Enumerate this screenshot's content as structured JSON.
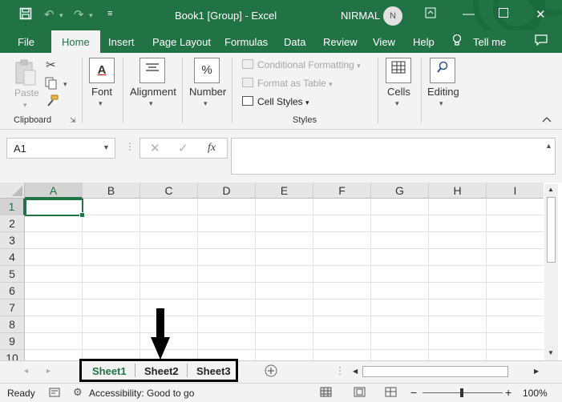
{
  "titlebar": {
    "title": "Book1  [Group]  -  Excel",
    "user": "NIRMAL",
    "avatar_initial": "N",
    "save_icon": "save-icon",
    "undo_icon": "undo-icon",
    "redo_icon": "redo-icon"
  },
  "tabs": [
    "File",
    "Home",
    "Insert",
    "Page Layout",
    "Formulas",
    "Data",
    "Review",
    "View",
    "Help",
    "Tell me"
  ],
  "ribbon": {
    "paste": "Paste",
    "clipboard": "Clipboard",
    "font": "Font",
    "alignment": "Alignment",
    "number": "Number",
    "conditional_formatting": "Conditional Formatting",
    "format_as_table": "Format as Table",
    "cell_styles": "Cell Styles",
    "styles": "Styles",
    "cells": "Cells",
    "editing": "Editing",
    "number_icon": "%"
  },
  "formula_bar": {
    "name_box": "A1",
    "fx": "fx"
  },
  "grid": {
    "columns": [
      "A",
      "B",
      "C",
      "D",
      "E",
      "F",
      "G",
      "H",
      "I"
    ],
    "rows": [
      "1",
      "2",
      "3",
      "4",
      "5",
      "6",
      "7",
      "8",
      "9",
      "10"
    ],
    "active_cell": "A1"
  },
  "sheets": [
    "Sheet1",
    "Sheet2",
    "Sheet3"
  ],
  "active_sheet": "Sheet1",
  "status": {
    "ready": "Ready",
    "accessibility": "Accessibility: Good to go",
    "zoom": "100%",
    "zoom_minus": "−",
    "zoom_plus": "+"
  },
  "colors": {
    "accent": "#217346"
  }
}
